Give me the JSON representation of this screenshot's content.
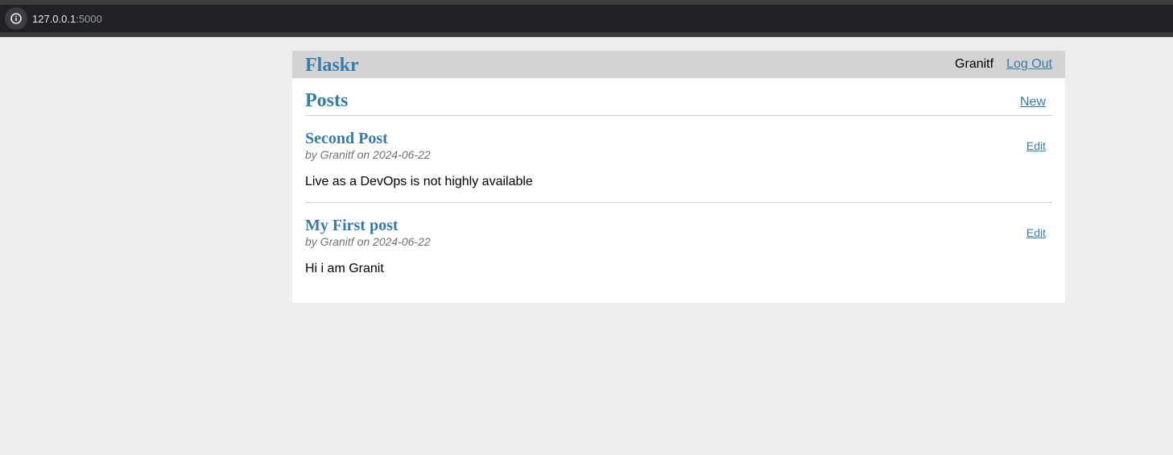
{
  "browser": {
    "url_host": "127.0.0.1",
    "url_port": ":5000"
  },
  "nav": {
    "brand": "Flaskr",
    "username": "Granitf",
    "logout_label": "Log Out"
  },
  "header": {
    "title": "Posts",
    "new_label": "New"
  },
  "posts": [
    {
      "title": "Second Post",
      "about": "by Granitf on 2024-06-22",
      "body": "Live as a DevOps is not highly available",
      "edit_label": "Edit"
    },
    {
      "title": "My First post",
      "about": "by Granitf on 2024-06-22",
      "body": "Hi i am Granit",
      "edit_label": "Edit"
    }
  ],
  "colors": {
    "accent": "#377ba8",
    "nav_bg": "#d3d3d3",
    "page_bg": "#ededed"
  }
}
